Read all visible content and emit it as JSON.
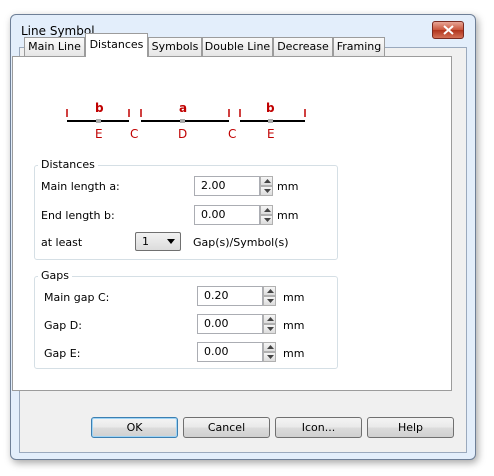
{
  "window": {
    "title": "Line Symbol"
  },
  "tabs": [
    {
      "label": "Main Line",
      "active": false
    },
    {
      "label": "Distances",
      "active": true
    },
    {
      "label": "Symbols",
      "active": false
    },
    {
      "label": "Double Line",
      "active": false
    },
    {
      "label": "Decrease",
      "active": false
    },
    {
      "label": "Framing",
      "active": false
    }
  ],
  "diagram": {
    "top_labels": [
      "b",
      "a",
      "b"
    ],
    "bottom_labels": [
      "E",
      "C",
      "D",
      "C",
      "E"
    ],
    "color": "#c00000"
  },
  "distances": {
    "title": "Distances",
    "main_length_label": "Main length a:",
    "main_length_value": "2.00",
    "end_length_label": "End length b:",
    "end_length_value": "0.00",
    "at_least_label": "at least",
    "at_least_value": "1",
    "gaps_symbols_label": "Gap(s)/Symbol(s)",
    "unit": "mm"
  },
  "gaps": {
    "title": "Gaps",
    "main_gap_label": "Main gap C:",
    "main_gap_value": "0.20",
    "gap_d_label": "Gap D:",
    "gap_d_value": "0.00",
    "gap_e_label": "Gap E:",
    "gap_e_value": "0.00",
    "unit": "mm"
  },
  "buttons": {
    "ok": "OK",
    "cancel": "Cancel",
    "icon": "Icon...",
    "help": "Help"
  }
}
